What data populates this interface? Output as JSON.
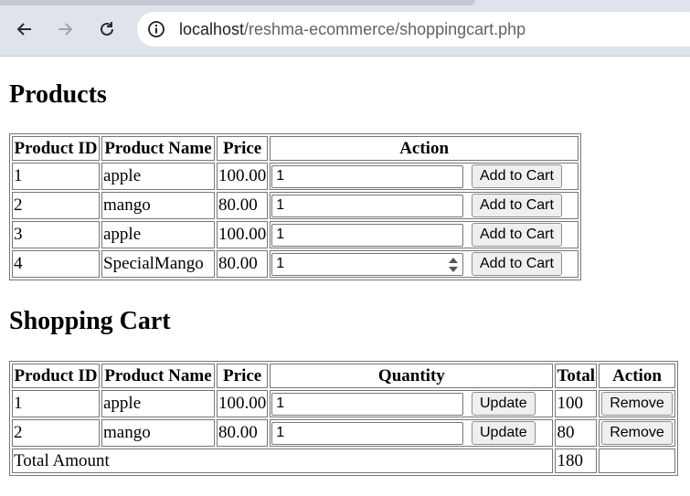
{
  "browser": {
    "url_host": "localhost",
    "url_path": "/reshma-ecommerce/shoppingcart.php"
  },
  "products": {
    "heading": "Products",
    "columns": [
      "Product ID",
      "Product Name",
      "Price",
      "Action"
    ],
    "rows": [
      {
        "id": "1",
        "name": "apple",
        "price": "100.00",
        "qty": "1",
        "button": "Add to Cart"
      },
      {
        "id": "2",
        "name": "mango",
        "price": "80.00",
        "qty": "1",
        "button": "Add to Cart"
      },
      {
        "id": "3",
        "name": "apple",
        "price": "100.00",
        "qty": "1",
        "button": "Add to Cart"
      },
      {
        "id": "4",
        "name": "SpecialMango",
        "price": "80.00",
        "qty": "1",
        "button": "Add to Cart"
      }
    ]
  },
  "cart": {
    "heading": "Shopping Cart",
    "columns": [
      "Product ID",
      "Product Name",
      "Price",
      "Quantity",
      "Total",
      "Action"
    ],
    "rows": [
      {
        "id": "1",
        "name": "apple",
        "price": "100.00",
        "qty": "1",
        "update": "Update",
        "total": "100",
        "remove": "Remove"
      },
      {
        "id": "2",
        "name": "mango",
        "price": "80.00",
        "qty": "1",
        "update": "Update",
        "total": "80",
        "remove": "Remove"
      }
    ],
    "total_label": "Total Amount",
    "total_value": "180"
  }
}
